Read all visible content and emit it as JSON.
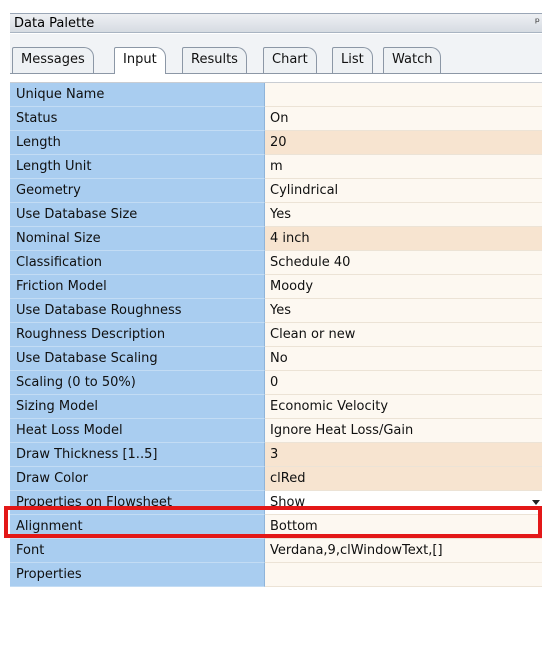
{
  "palette": {
    "title": "Data Palette",
    "pin_glyph": "ᵖ"
  },
  "tabs": [
    {
      "label": "Messages"
    },
    {
      "label": "Input"
    },
    {
      "label": "Results"
    },
    {
      "label": "Chart"
    },
    {
      "label": "List"
    },
    {
      "label": "Watch"
    }
  ],
  "active_tab": "Input",
  "properties": [
    {
      "name": "Unique Name",
      "value": ""
    },
    {
      "name": "Status",
      "value": "On"
    },
    {
      "name": "Length",
      "value": "20"
    },
    {
      "name": "Length Unit",
      "value": "m"
    },
    {
      "name": "Geometry",
      "value": "Cylindrical"
    },
    {
      "name": "Use Database Size",
      "value": "Yes"
    },
    {
      "name": "Nominal Size",
      "value": "4 inch"
    },
    {
      "name": "Classification",
      "value": "Schedule 40"
    },
    {
      "name": "Friction Model",
      "value": "Moody"
    },
    {
      "name": "Use Database Roughness",
      "value": "Yes"
    },
    {
      "name": "Roughness Description",
      "value": "Clean or new"
    },
    {
      "name": "Use Database Scaling",
      "value": "No"
    },
    {
      "name": "Scaling (0 to 50%)",
      "value": "0"
    },
    {
      "name": "Sizing Model",
      "value": "Economic Velocity"
    },
    {
      "name": "Heat Loss Model",
      "value": "Ignore Heat Loss/Gain"
    },
    {
      "name": "Draw Thickness [1..5]",
      "value": "3"
    },
    {
      "name": "Draw Color",
      "value": "clRed"
    },
    {
      "name": "Properties on Flowsheet",
      "value": "Show"
    },
    {
      "name": "Alignment",
      "value": "Bottom"
    },
    {
      "name": "Font",
      "value": "Verdana,9,clWindowText,[]"
    },
    {
      "name": "Properties",
      "value": ""
    }
  ],
  "colors": {
    "label_bg": "#a9cdf0",
    "value_bg": "#fdf8f1",
    "value_alt_bg": "#f7e4d0",
    "highlight_border": "#e31818"
  }
}
